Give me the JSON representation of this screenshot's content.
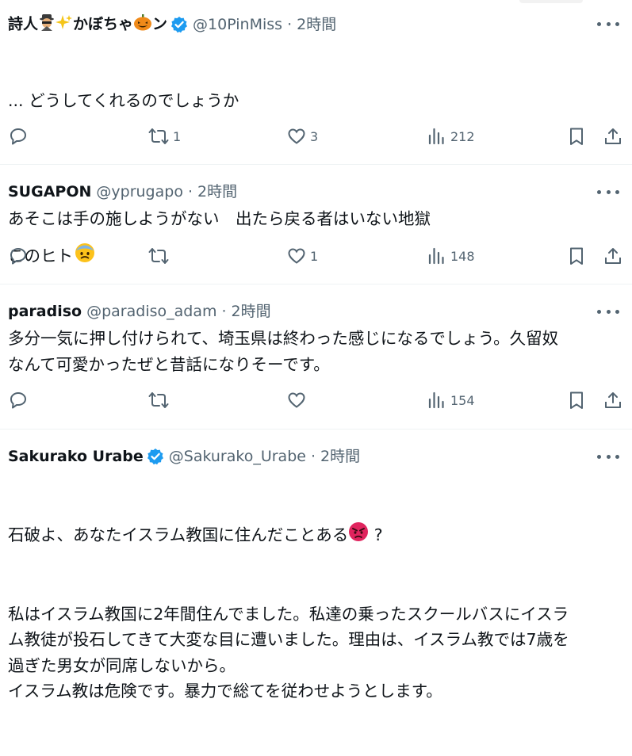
{
  "tweets": [
    {
      "name_prefix": "詩人",
      "name_suffix": "かぼちゃ",
      "name_end": "ン",
      "handle": "@10PinMiss",
      "sep": "·",
      "time": "2時間",
      "text_line1": "... どうしてくれるのでしょうか",
      "text_line3": "このヒト",
      "replies": "",
      "retweets": "1",
      "likes": "3",
      "views": "212"
    },
    {
      "name": "SUGAPON",
      "handle": "@yprugapo",
      "sep": "·",
      "time": "2時間",
      "text": "あそこは手の施しようがない　出たら戻る者はいない地獄",
      "replies": "",
      "retweets": "",
      "likes": "1",
      "views": "148"
    },
    {
      "name": "paradiso",
      "handle": "@paradiso_adam",
      "sep": "·",
      "time": "2時間",
      "text": "多分一気に押し付けられて、埼玉県は終わった感じになるでしょう。久留奴\nなんて可愛かったぜと昔話になりそーです。",
      "replies": "",
      "retweets": "",
      "likes": "",
      "views": "154"
    },
    {
      "name": "Sakurako Urabe",
      "handle": "@Sakurako_Urabe",
      "sep": "·",
      "time": "2時間",
      "text_line1": "石破よ、あなたイスラム教国に住んだことある",
      "text_line1_end": " ?",
      "text_rest": "私はイスラム教国に2年間住んでました。私達の乗ったスクールバスにイスラ\nム教徒が投石してきて大変な目に遭いました。理由は、イスラム教では7歳を\n過ぎた男女が同席しないから。\nイスラム教は危険です。暴力で総てを従わせようとします。"
    }
  ],
  "icons": [
    "reply-icon",
    "retweet-icon",
    "like-icon",
    "views-icon",
    "bookmark-icon",
    "share-icon",
    "more-icon",
    "verified-badge-icon",
    "spy-emoji-icon",
    "sparkles-emoji-icon",
    "pumpkin-emoji-icon",
    "fearful-face-emoji-icon",
    "angry-face-emoji-icon"
  ],
  "colors": {
    "text": "#0f1419",
    "secondary": "#536471",
    "verified": "#1d9bf0",
    "divider": "#eff3f4"
  }
}
